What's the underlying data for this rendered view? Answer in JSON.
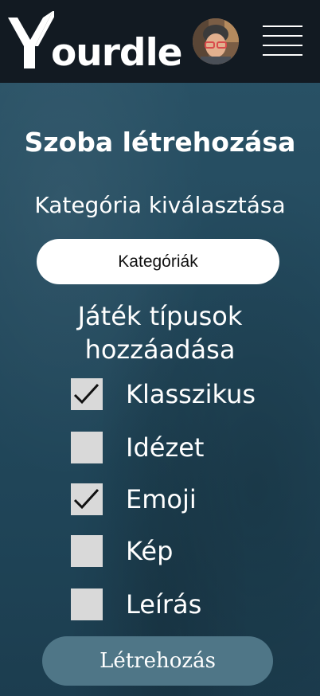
{
  "header": {
    "logo_text": "ourdle",
    "logo_icon": "yourdle-y-logo",
    "avatar_icon": "user-avatar",
    "menu_icon": "hamburger-menu-icon"
  },
  "main": {
    "title": "Szoba létrehozása",
    "category_label": "Kategória kiválasztása",
    "category_button_label": "Kategóriák",
    "game_types_label_line1": "Játék típusok",
    "game_types_label_line2": "hozzáadása",
    "game_types": [
      {
        "label": "Klasszikus",
        "checked": true
      },
      {
        "label": "Idézet",
        "checked": false
      },
      {
        "label": "Emoji",
        "checked": true
      },
      {
        "label": "Kép",
        "checked": false
      },
      {
        "label": "Leírás",
        "checked": false
      }
    ],
    "create_button_label": "Létrehozás"
  },
  "colors": {
    "header_bg": "#121a22",
    "page_bg": "#24495d",
    "checkbox_bg": "#d9d9d9",
    "create_button_bg": "#4f7687"
  }
}
